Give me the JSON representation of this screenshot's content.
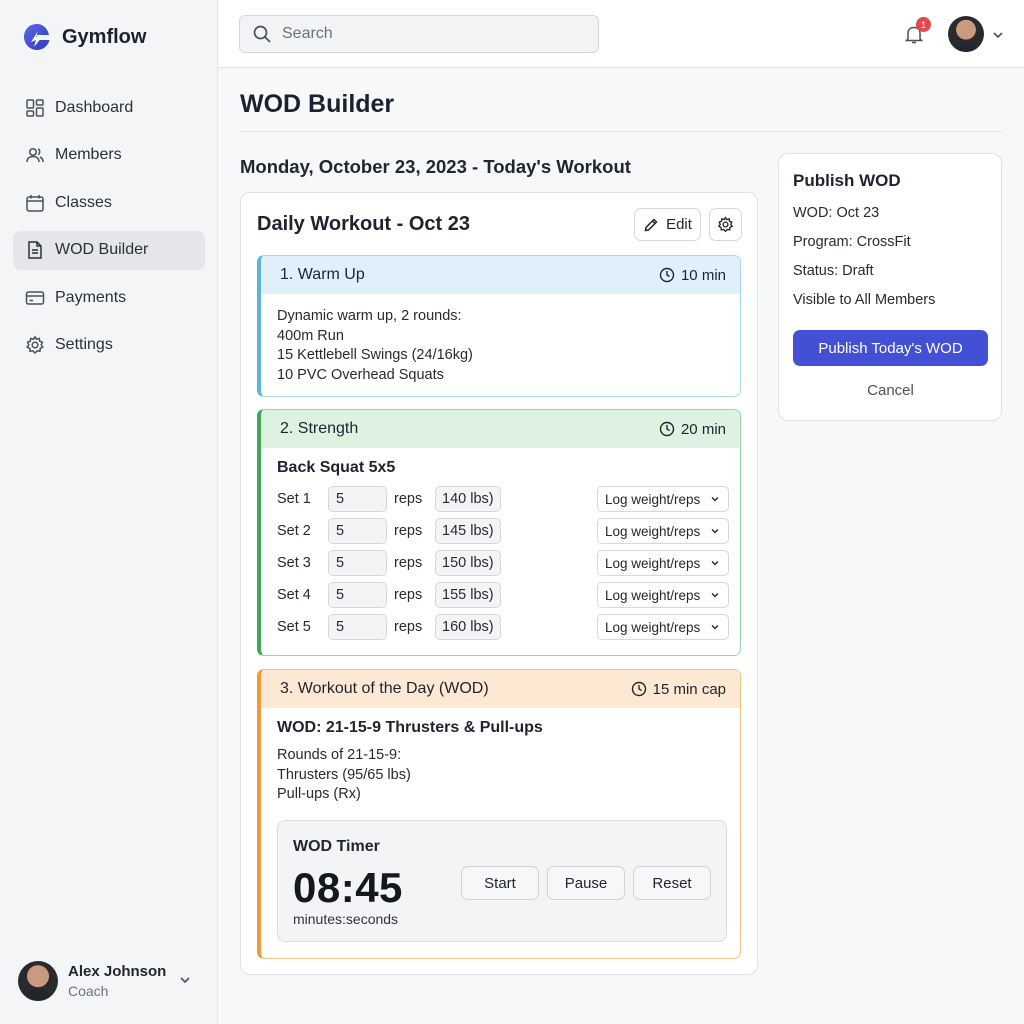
{
  "app": {
    "name": "Gymflow",
    "accent": "#4350d6"
  },
  "sidebar": {
    "items": [
      {
        "label": "Dashboard",
        "icon": "dashboard-icon"
      },
      {
        "label": "Members",
        "icon": "members-icon"
      },
      {
        "label": "Classes",
        "icon": "calendar-icon"
      },
      {
        "label": "WOD Builder",
        "icon": "document-icon",
        "active": true
      },
      {
        "label": "Payments",
        "icon": "credit-card-icon"
      },
      {
        "label": "Settings",
        "icon": "gear-icon"
      }
    ],
    "user": {
      "name": "Alex Johnson",
      "role": "Coach"
    }
  },
  "topbar": {
    "search_placeholder": "Search",
    "notification_count": "1"
  },
  "main": {
    "title": "WOD Builder",
    "date_heading": "Monday, October 23, 2023 - Today's Workout"
  },
  "workout": {
    "title": "Daily Workout - Oct 23",
    "edit_label": "Edit",
    "sections": [
      {
        "title": "1. Warm Up",
        "duration": "10 min",
        "color": "#5fb4dc",
        "lines": [
          "Dynamic warm up, 2 rounds:",
          "400m Run",
          "15 Kettlebell Swings (24/16kg)",
          "10 PVC Overhead Squats"
        ]
      },
      {
        "title": "2. Strength",
        "duration": "20 min",
        "color": "#3fa65a",
        "subtitle": "Back Squat 5x5",
        "sets": [
          {
            "label": "Set 1",
            "reps": "5",
            "unit": "reps",
            "weight": "140 lbs)",
            "log": "Log weight/reps"
          },
          {
            "label": "Set 2",
            "reps": "5",
            "unit": "reps",
            "weight": "145 lbs)",
            "log": "Log weight/reps"
          },
          {
            "label": "Set 3",
            "reps": "5",
            "unit": "reps",
            "weight": "150 lbs)",
            "log": "Log weight/reps"
          },
          {
            "label": "Set 4",
            "reps": "5",
            "unit": "reps",
            "weight": "155 lbs)",
            "log": "Log weight/reps"
          },
          {
            "label": "Set 5",
            "reps": "5",
            "unit": "reps",
            "weight": "160 lbs)",
            "log": "Log weight/reps"
          }
        ]
      },
      {
        "title": "3. Workout of the Day (WOD)",
        "duration": "15 min cap",
        "color": "#f09a3a",
        "subtitle": "WOD: 21-15-9 Thrusters & Pull-ups",
        "lines": [
          "Rounds of 21-15-9:",
          "Thrusters (95/65 lbs)",
          "Pull-ups (Rx)"
        ]
      }
    ],
    "timer": {
      "label": "WOD Timer",
      "time": "08:45",
      "unit": "minutes:seconds",
      "start": "Start",
      "pause": "Pause",
      "reset": "Reset"
    }
  },
  "publish": {
    "title": "Publish WOD",
    "wod": "WOD: Oct 23",
    "program": "Program: CrossFit",
    "status": "Status: Draft",
    "visibility": "Visible to All Members",
    "publish_label": "Publish Today's WOD",
    "cancel_label": "Cancel"
  }
}
